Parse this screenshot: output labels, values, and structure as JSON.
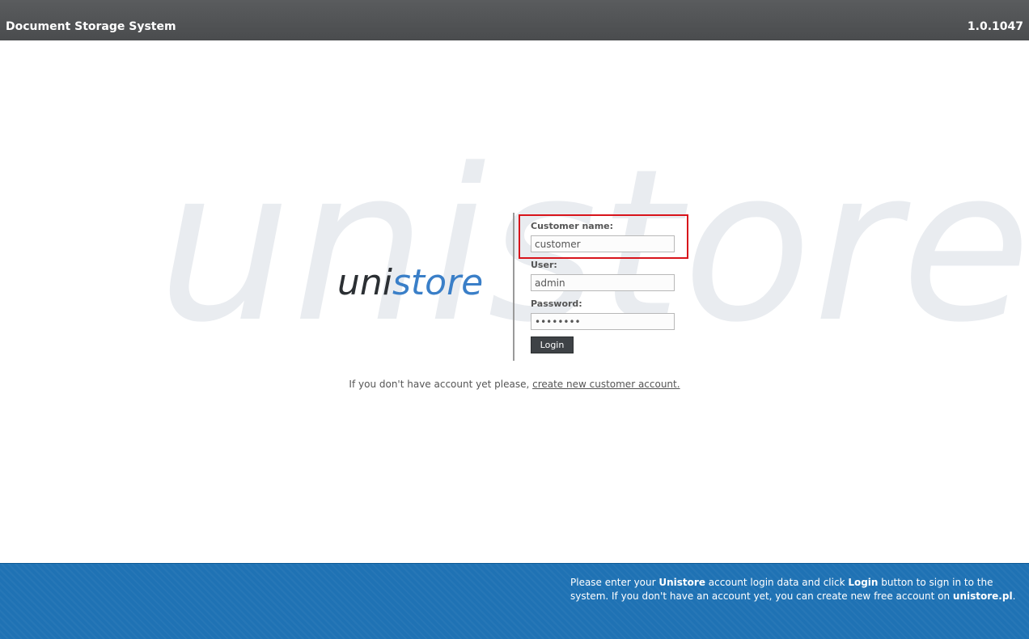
{
  "header": {
    "title": "Document Storage System",
    "version": "1.0.1047"
  },
  "branding": {
    "watermark_text": "unistore",
    "logo_part1": "uni",
    "logo_part2": "store",
    "logo_accent_color": "#3a7fc8"
  },
  "login_form": {
    "customer_label": "Customer name:",
    "customer_value": "customer",
    "user_label": "User:",
    "user_value": "admin",
    "password_label": "Password:",
    "password_value": "********",
    "login_button": "Login"
  },
  "signup": {
    "prefix": "If you don't have account yet please,",
    "link_text": "create new customer account."
  },
  "footer": {
    "t1": "Please enter your ",
    "b1": "Unistore",
    "t2": " account login data and click ",
    "b2": "Login",
    "t3": " button to sign in to the system. If you don't have an account yet, you can create new free account on ",
    "b3": "unistore.pl",
    "t4": "."
  },
  "colors": {
    "header_bg": "#4f5153",
    "footer_bg": "#1f72b4",
    "highlight": "#d8141b"
  }
}
